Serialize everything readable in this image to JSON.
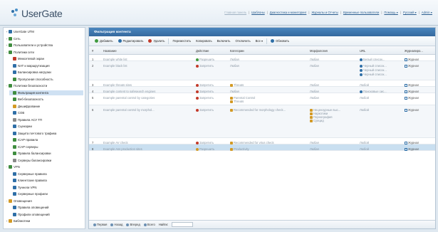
{
  "app": {
    "logo_text": "UserGate"
  },
  "topnav": [
    {
      "label": "Главная панель",
      "dim": true
    },
    {
      "label": "Шаблоны",
      "dim": false
    },
    {
      "label": "Диагностика и мониторинг",
      "dim": false
    },
    {
      "label": "Журналы и Отчеты",
      "dim": false
    },
    {
      "label": "Временные пользователи",
      "dim": false
    },
    {
      "label": "Помощь ▾",
      "dim": false
    },
    {
      "label": "Русский ▾",
      "dim": false
    },
    {
      "label": "Admin ▾",
      "dim": false
    }
  ],
  "sidebar": {
    "items": [
      {
        "label": "UserGate UTM",
        "tw": "+",
        "color": "#2f6fa7"
      },
      {
        "label": "Сеть",
        "tw": "+",
        "color": "#3f8d3f"
      },
      {
        "label": "Пользователи и устройства",
        "tw": "+",
        "color": "#3f8d3f"
      },
      {
        "label": "Политики сети",
        "tw": "−",
        "color": "#3f8d3f"
      },
      {
        "label": "Межсетевой экран",
        "tw": "",
        "color": "#c23a2a"
      },
      {
        "label": "NAT и маршрутизация",
        "tw": "",
        "color": "#2f6fa7"
      },
      {
        "label": "Балансировка нагрузки",
        "tw": "",
        "color": "#2f6fa7"
      },
      {
        "label": "Пропускная способность",
        "tw": "",
        "color": "#3f8d3f"
      },
      {
        "label": "Политики безопасности",
        "tw": "−",
        "color": "#3f8d3f"
      },
      {
        "label": "Фильтрация контента",
        "tw": "",
        "color": "#3f8d3f",
        "selected": true
      },
      {
        "label": "Веб-безопасность",
        "tw": "",
        "color": "#3f8d3f"
      },
      {
        "label": "Дешифрование",
        "tw": "",
        "color": "#d39a25"
      },
      {
        "label": "СОВ",
        "tw": "",
        "color": "#2f6fa7"
      },
      {
        "label": "Правила АСУ ТП",
        "tw": "",
        "color": "#8a8a8a"
      },
      {
        "label": "Сценарии",
        "tw": "",
        "color": "#2f6fa7"
      },
      {
        "label": "Защита почтового трафика",
        "tw": "",
        "color": "#2f6fa7"
      },
      {
        "label": "ICAP-правила",
        "tw": "",
        "color": "#3f8d3f"
      },
      {
        "label": "ICAP-серверы",
        "tw": "",
        "color": "#3f8d3f"
      },
      {
        "label": "Правила балансировки",
        "tw": "",
        "color": "#3f8d3f"
      },
      {
        "label": "Серверы балансировки",
        "tw": "",
        "color": "#8a8a8a"
      },
      {
        "label": "VPN",
        "tw": "−",
        "color": "#3f8d3f"
      },
      {
        "label": "Серверные правила",
        "tw": "",
        "color": "#2f6fa7"
      },
      {
        "label": "Клиентские правила",
        "tw": "",
        "color": "#2f6fa7"
      },
      {
        "label": "Туннели VPN",
        "tw": "",
        "color": "#2f6fa7"
      },
      {
        "label": "Серверные профили",
        "tw": "",
        "color": "#2f6fa7"
      },
      {
        "label": "Оповещения",
        "tw": "−",
        "color": "#d39a25"
      },
      {
        "label": "Правила оповещений",
        "tw": "",
        "color": "#2f6fa7"
      },
      {
        "label": "Профили оповещений",
        "tw": "",
        "color": "#2f6fa7"
      },
      {
        "label": "Библиотеки",
        "tw": "+",
        "color": "#d39a25"
      }
    ]
  },
  "panel": {
    "title": "Фильтрация контента"
  },
  "toolbar": [
    {
      "label": "Добавить",
      "icon": "plus-icon",
      "color": "#3f9a3f"
    },
    {
      "label": "Редактировать",
      "icon": "edit-icon",
      "color": "#2f6fa7"
    },
    {
      "label": "Удалить",
      "icon": "delete-icon",
      "color": "#c23a2a"
    },
    {
      "label": "Переместить",
      "icon": "move-icon",
      "color": ""
    },
    {
      "label": "Копировать",
      "icon": "copy-icon",
      "color": ""
    },
    {
      "label": "Включить",
      "icon": "enable-icon",
      "color": ""
    },
    {
      "label": "Отключить",
      "icon": "disable-icon",
      "color": ""
    },
    {
      "label": "Все ▾",
      "icon": "filter-icon",
      "color": ""
    },
    {
      "label": "Обновить",
      "icon": "refresh-icon",
      "color": "#2f6fa7"
    }
  ],
  "grid": {
    "headers": [
      "#",
      "Название",
      "Действие",
      "Категории",
      "Морфология",
      "URL",
      "Журналиро..."
    ],
    "rows": [
      {
        "num": "1",
        "name": "Example white list",
        "action": "Разрешить",
        "action_color": "#3f9a3f",
        "categories": [
          "Любая"
        ],
        "cat_colors": [
          ""
        ],
        "morph": [
          "Любая"
        ],
        "urls": [
          "Белый список..."
        ],
        "log": "Журнал",
        "height": 9
      },
      {
        "num": "2",
        "name": "Example black list",
        "action": "Запретить",
        "action_color": "#c23a2a",
        "categories": [
          "Любая"
        ],
        "cat_colors": [
          ""
        ],
        "morph": [
          "Любая"
        ],
        "urls": [
          "Черный список...",
          "Черный список...",
          "Черный список..."
        ],
        "log": "Журнал",
        "height": 27
      },
      {
        "num": "3",
        "name": "Example threats sites",
        "action": "Запретить",
        "action_color": "#c23a2a",
        "categories": [
          "Threats"
        ],
        "cat_colors": [
          "#d39a25"
        ],
        "morph": [
          "Любая"
        ],
        "urls": [
          "Любой"
        ],
        "log": "Журнал",
        "height": 9
      },
      {
        "num": "4",
        "name": "Example content to safesearch engines",
        "action": "Запретить",
        "action_color": "#c23a2a",
        "categories": [
          "Любая"
        ],
        "cat_colors": [
          ""
        ],
        "morph": [
          "Любая"
        ],
        "urls": [
          "Поисковые сис..."
        ],
        "log": "Журнал",
        "height": 9
      },
      {
        "num": "5",
        "name": "Example parental control by categories",
        "action": "Запретить",
        "action_color": "#c23a2a",
        "categories": [
          "Parental Control",
          "Threats"
        ],
        "cat_colors": [
          "#d39a25",
          "#d39a25"
        ],
        "morph": [
          "Любая"
        ],
        "urls": [
          "Любой"
        ],
        "log": "Журнал",
        "height": 17
      },
      {
        "num": "6",
        "name": "Example parental control by morphol...",
        "action": "Запретить",
        "action_color": "#c23a2a",
        "categories": [
          "Recommended for morphology check..."
        ],
        "cat_colors": [
          "#d39a25"
        ],
        "morph": [
          "Нецензурные выс...",
          "Наркотики",
          "Порнография",
          "Суицид"
        ],
        "urls": [
          "Любой"
        ],
        "log": "Журнал",
        "height": 46
      },
      {
        "num": "7",
        "name": "Example AV check",
        "action": "Запретить",
        "action_color": "#c23a2a",
        "categories": [
          "Recommended for virus check"
        ],
        "cat_colors": [
          "#d39a25"
        ],
        "morph": [
          "Любая"
        ],
        "urls": [
          "Любой"
        ],
        "log": "Журнал",
        "height": 9
      },
      {
        "num": "8",
        "name": "Example Ass production sites",
        "action": "Разрешить",
        "action_color": "#d39a25",
        "categories": [
          "Productivity"
        ],
        "cat_colors": [
          "#d39a25"
        ],
        "morph": [
          "Любая"
        ],
        "urls": [
          "Любой"
        ],
        "log": "Журнал",
        "height": 9,
        "selected": true
      }
    ]
  },
  "bottombar": {
    "buttons": [
      "Первая",
      "Назад",
      "Вперед",
      "Всего"
    ],
    "search_label": "Найти:"
  }
}
